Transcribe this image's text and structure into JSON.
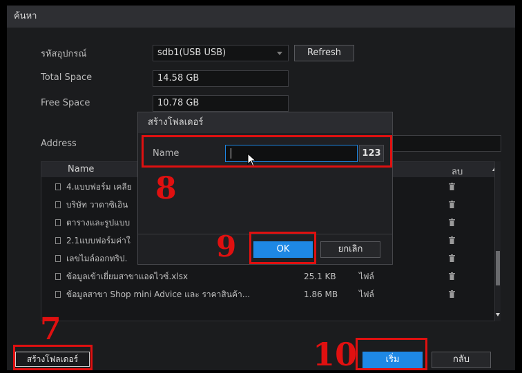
{
  "window": {
    "title": "ค้นหา"
  },
  "form": {
    "device_label": "รหัสอุปกรณ์",
    "device_value": "sdb1(USB USB)",
    "refresh_label": "Refresh",
    "total_label": "Total Space",
    "total_value": "14.58 GB",
    "free_label": "Free Space",
    "free_value": "10.78 GB",
    "address_label": "Address"
  },
  "table": {
    "headers": {
      "name": "Name",
      "delete": "ลบ"
    },
    "rows": [
      {
        "name": "4.แบบฟอร์ม เคลีย",
        "size": "",
        "type": ""
      },
      {
        "name": "บริษัท วาดาซิเอิน",
        "size": "",
        "type": ""
      },
      {
        "name": "ตารางและรูปแบบ",
        "size": "",
        "type": ""
      },
      {
        "name": "2.1แบบฟอร์มค่าใ",
        "size": "",
        "type": ""
      },
      {
        "name": "เลขไมล์ออกทริป.",
        "size": "",
        "type": ""
      },
      {
        "name": "ข้อมูลเข้าเยี่ยมสาขาแอดไวซ์.xlsx",
        "size": "25.1 KB",
        "type": "ไฟล์"
      },
      {
        "name": "ข้อมูลสาขา Shop mini Advice และ ราคาสินค้า...",
        "size": "1.86 MB",
        "type": "ไฟล์"
      }
    ]
  },
  "dialog": {
    "title": "สร้างโฟลเดอร์",
    "name_label": "Name",
    "name_value": "",
    "keyboard_label": "123",
    "ok_label": "OK",
    "cancel_label": "ยกเลิก"
  },
  "footer": {
    "create_folder_label": "สร้างโฟลเดอร์",
    "start_label": "เริ่ม",
    "back_label": "กลับ"
  },
  "annotations": {
    "step7": "7",
    "step8": "8",
    "step9": "9",
    "step10": "10"
  },
  "colors": {
    "accent": "#1e88e5",
    "highlight": "#e01010",
    "background": "#1b1c1e"
  },
  "icons": {
    "file": "document-icon",
    "delete": "trash-icon",
    "dropdown": "dropdown-arrow-icon"
  }
}
